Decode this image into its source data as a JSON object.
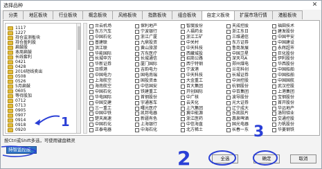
{
  "window": {
    "title": "选择品种",
    "close_glyph": "✕"
  },
  "tabs": [
    "分类",
    "地区板块",
    "行业板块",
    "概念板块",
    "风格板块",
    "指数板块",
    "组合板块",
    "自定义板块",
    "扩展市场行情",
    "港股板块"
  ],
  "active_tab": 7,
  "tree": {
    "items": [
      "1117",
      "1227",
      "持仓监测板块",
      "持仓盈利股",
      "扁鼓股",
      "本周扁鼓",
      "长线套利",
      "0421",
      "0428",
      "2016短线卖出",
      "0508",
      "0526",
      "5月扁鼓",
      "0605",
      "等待股加",
      "0712",
      "0713",
      "0905",
      "0907",
      "0914",
      "0918",
      "0920"
    ],
    "selected_label": "持智监控股"
  },
  "grid": {
    "columns": [
      [
        "台云机场",
        "东方汽车",
        "中国石化",
        "普建联",
        "洪江联",
        "华能国际",
        "长城申万",
        "华新证券",
        "日照港",
        "中国电力",
        "上海航空",
        "海南航空",
        "中国石化",
        "华电国际",
        "中国交建",
        "三一重工",
        "中国中铁",
        "楚天高速",
        "中国石化",
        "正泰电器"
      ],
      [
        "保利地产",
        "宁波银行",
        "浙江广厦",
        "九鼎投资",
        "黄山旅游",
        "万东医疗",
        "长城通信",
        "厦门国际",
        "吉韵电力",
        "国电南瑞",
        "国投资本",
        "中信国安",
        "铁建重工",
        "首钢股份",
        "宇通客车",
        "曙光医疗",
        "凯邦电器",
        "新疆有色",
        "上海银行",
        "中海石化"
      ],
      [
        "智度股份",
        "人福药业",
        "浙江工矿",
        "中关村",
        "中天科技",
        "西藏城投",
        "招商公路",
        "西宁特钢",
        "宁波港",
        "中天科技",
        "大金重工",
        "百大集团",
        "开创国际",
        "中广核",
        "云天化",
        "上汽集团",
        "冀中能源",
        "浙江医药",
        "中信海直",
        "北方稀土"
      ],
      [
        "天成控股",
        "浙江东日",
        "三维通信",
        "东方证券",
        "鲁商发展",
        "中国卫星",
        "深天马A",
        "郑州煤电",
        "兰花科创",
        "长城证券",
        "中洲控股",
        "杭钢股份",
        "中百集团",
        "波导股份",
        "光大证券",
        "辽宁成大",
        "乐凯胶片",
        "惠泉啤酒",
        "国光电器",
        "长春一东"
      ],
      [
        "福田技术",
        "建发股份",
        "中国平安",
        "中国建设",
        "永辉超市",
        "巨化股份",
        "伊利股份",
        "华西股份",
        "中国船舶",
        "中国船舶",
        "中国国航",
        "武汉控股",
        "上港集团",
        "宝钢股份",
        "首开股份",
        "华远地产",
        "洛阳钼业",
        "交通控股",
        "力帆股份",
        "华菱钢铁"
      ]
    ]
  },
  "status_text": "按Ctrl或Shift多选，可使用键盘精灵",
  "buttons": {
    "select_all": "全选",
    "ok": "确定",
    "cancel": "取消"
  },
  "annotations": {
    "n1": "1",
    "n2": "2",
    "n3": "3"
  },
  "colors": {
    "annotation": "#2a3fd6",
    "selected": "#2f72c4"
  }
}
